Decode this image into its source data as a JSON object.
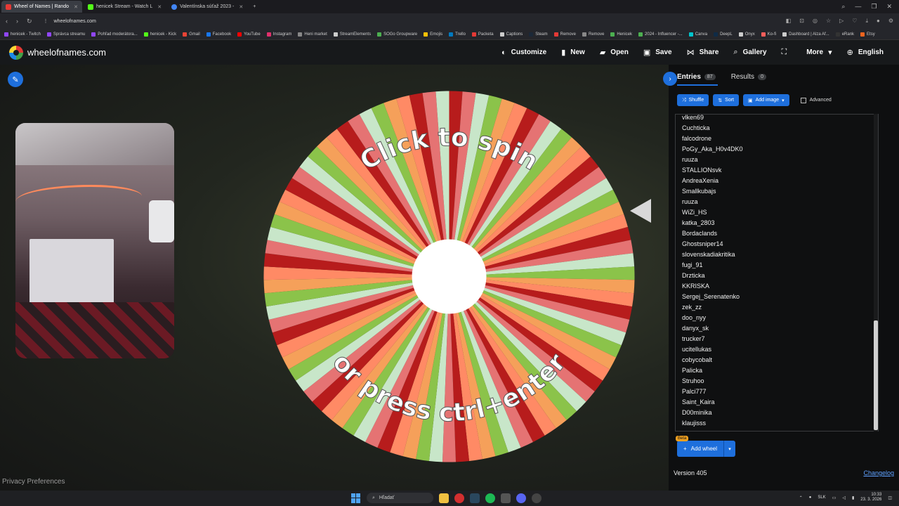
{
  "browser": {
    "tabs": [
      {
        "title": "Wheel of Names | Rando",
        "active": true,
        "color": "#e53935"
      },
      {
        "title": "henicek Stream - Watch L",
        "active": false,
        "color": "#53fc18"
      },
      {
        "title": "Valentínska súťaž 2023 - ",
        "active": false,
        "color": "#4285f4"
      }
    ],
    "url": "wheelofnames.com",
    "bookmarks": [
      {
        "label": "henicek - Twitch",
        "color": "#9146ff"
      },
      {
        "label": "Správca streamu",
        "color": "#9146ff"
      },
      {
        "label": "Pohľad moderátora...",
        "color": "#9146ff"
      },
      {
        "label": "henicek - Kick",
        "color": "#53fc18"
      },
      {
        "label": "Gmail",
        "color": "#ea4335"
      },
      {
        "label": "Facebook",
        "color": "#1877f2"
      },
      {
        "label": "YouTube",
        "color": "#ff0000"
      },
      {
        "label": "Instagram",
        "color": "#e1306c"
      },
      {
        "label": "Heni market",
        "color": "#888888"
      },
      {
        "label": "StreamElements",
        "color": "#cccccc"
      },
      {
        "label": "SOGo Groupware",
        "color": "#4caf50"
      },
      {
        "label": "Emojis",
        "color": "#ffc107"
      },
      {
        "label": "Trello",
        "color": "#0079bf"
      },
      {
        "label": "Packeta",
        "color": "#e53935"
      },
      {
        "label": "Captions",
        "color": "#cccccc"
      },
      {
        "label": "Steam",
        "color": "#1b2838"
      },
      {
        "label": "Remove",
        "color": "#e53935"
      },
      {
        "label": "Remove",
        "color": "#888888"
      },
      {
        "label": "Henicek",
        "color": "#4caf50"
      },
      {
        "label": "2024 - Influencer -...",
        "color": "#4caf50"
      },
      {
        "label": "Canva",
        "color": "#00c4cc"
      },
      {
        "label": "DeepL",
        "color": "#0f2b46"
      },
      {
        "label": "Onyx",
        "color": "#cccccc"
      },
      {
        "label": "Ko-fi",
        "color": "#ff5e5b"
      },
      {
        "label": "Dashboard | Alza Af...",
        "color": "#cccccc"
      },
      {
        "label": "eRank",
        "color": "#333333"
      },
      {
        "label": "Etsy",
        "color": "#f1641e"
      }
    ]
  },
  "app": {
    "site_name": "wheelofnames.com",
    "menu": [
      {
        "label": "Customize",
        "icon": "palette-icon",
        "glyph": "◐"
      },
      {
        "label": "New",
        "icon": "file-icon",
        "glyph": "▮"
      },
      {
        "label": "Open",
        "icon": "folder-icon",
        "glyph": "▰"
      },
      {
        "label": "Save",
        "icon": "save-icon",
        "glyph": "▣"
      },
      {
        "label": "Share",
        "icon": "share-icon",
        "glyph": "⋈"
      },
      {
        "label": "Gallery",
        "icon": "search-icon",
        "glyph": "⌕"
      },
      {
        "label": "",
        "icon": "fullscreen-icon",
        "glyph": "⛶"
      },
      {
        "label": "More",
        "icon": "chevron-down-icon",
        "glyph": "▾"
      },
      {
        "label": "English",
        "icon": "globe-icon",
        "glyph": "⊕"
      }
    ],
    "privacy": "Privacy Preferences"
  },
  "wheel": {
    "spin_text_top": "Click to spin",
    "spin_text_bottom": "or press ctrl+enter",
    "colors": [
      "#b71c1c",
      "#e57373",
      "#c8e6c9",
      "#8bc34a",
      "#f5a05a",
      "#ff8a65"
    ]
  },
  "panel": {
    "tab_entries": "Entries",
    "entries_count": "87",
    "tab_results": "Results",
    "results_count": "0",
    "shuffle": "Shuffle",
    "sort": "Sort",
    "add_image": "Add image",
    "advanced": "Advanced",
    "entries": [
      "vlken69",
      "Cuchticka",
      "falcodrone",
      "PoGy_Aka_H0v4DK0",
      "ruuza",
      "STALLIONsvk",
      "AndreaXenia",
      "Smallkubajs",
      "ruuza",
      "WiZi_HS",
      "katka_2803",
      "Bordaclands",
      "Ghostsniper14",
      "slovenskadiakritika",
      "fugi_91",
      "Drzticka",
      "KKRISKA",
      "Sergej_Serenatenko",
      "zek_zz",
      "doo_nyy",
      "danyx_sk",
      "trucker7",
      "ucitellukas",
      "cobycobalt",
      "Palicka",
      "Struhoo",
      "Palci777",
      "Saint_Kaira",
      "D00minika",
      " klaujisss"
    ],
    "beta": "Beta",
    "add_wheel": "Add wheel",
    "version": "Version 405",
    "changelog": "Changelog"
  },
  "taskbar": {
    "search": "Hľadať",
    "lang": "SLK",
    "time": "10:33",
    "date": "23. 3. 2026"
  }
}
